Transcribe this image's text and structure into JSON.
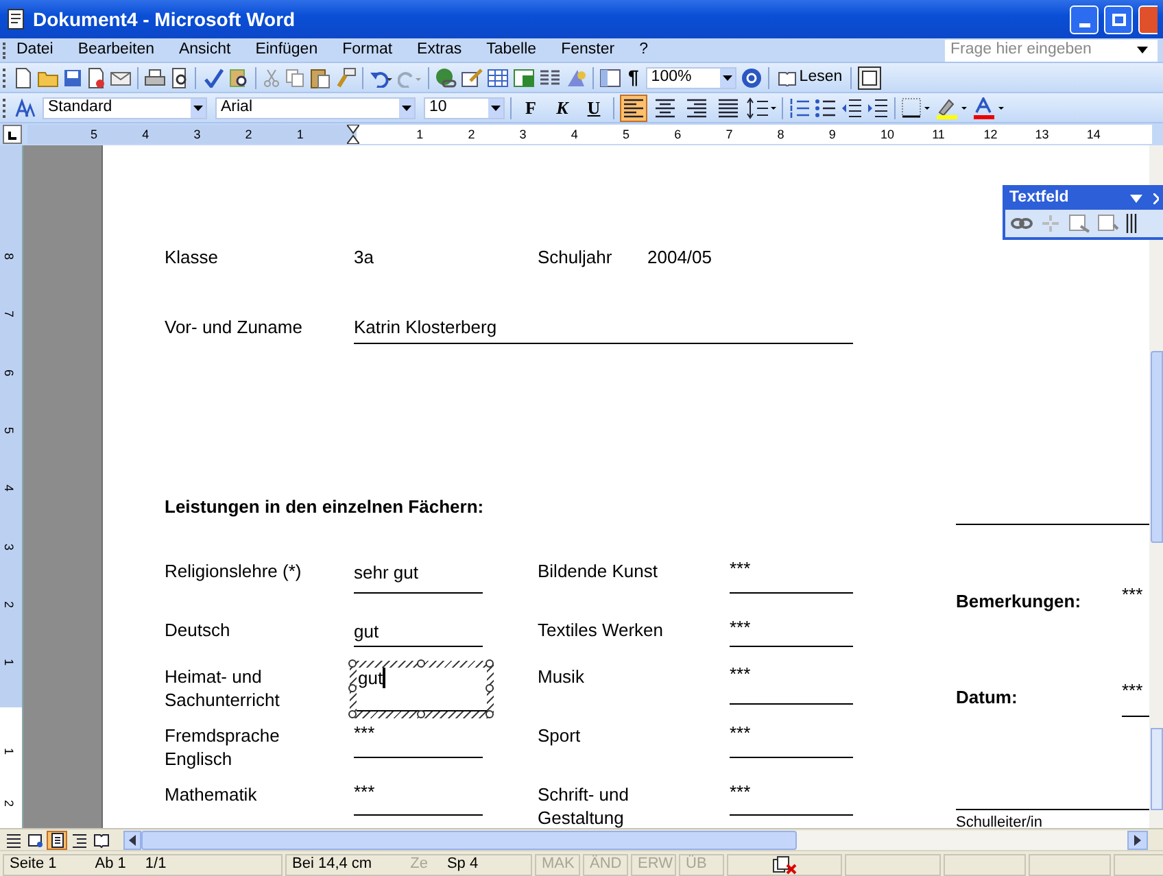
{
  "window": {
    "title": "Dokument4 - Microsoft Word"
  },
  "menu": [
    "Datei",
    "Bearbeiten",
    "Ansicht",
    "Einfügen",
    "Format",
    "Extras",
    "Tabelle",
    "Fenster",
    "?"
  ],
  "help_search": {
    "placeholder": "Frage hier eingeben"
  },
  "standard_toolbar": {
    "show_marks": "¶",
    "zoom": "100%",
    "read_button": "Lesen"
  },
  "format_toolbar": {
    "style": "Standard",
    "font": "Arial",
    "size": "10",
    "bold": "F",
    "italic": "K",
    "underline": "U",
    "alignments": [
      {
        "kind": "left",
        "selected": true
      },
      {
        "kind": "center",
        "selected": false
      },
      {
        "kind": "right",
        "selected": false
      },
      {
        "kind": "justify",
        "selected": false
      }
    ]
  },
  "ruler": {
    "left_ticks": [
      "5",
      "4",
      "3",
      "2",
      "1"
    ],
    "right_ticks": [
      "1",
      "2",
      "3",
      "4",
      "5",
      "6",
      "7",
      "8",
      "9",
      "10",
      "11",
      "12",
      "13",
      "14"
    ]
  },
  "vertical_ruler": {
    "upper_ticks": [
      "8",
      "7",
      "6",
      "5",
      "4",
      "3",
      "2",
      "1"
    ],
    "lower_ticks": [
      "1",
      "2"
    ]
  },
  "textbox_toolbar": {
    "title": "Textfeld"
  },
  "document": {
    "class_label": "Klasse",
    "class_value": "3a",
    "year_label": "Schuljahr",
    "year_value": "2004/05",
    "name_label": "Vor- und Zuname",
    "name_value": "Katrin Klosterberg",
    "heading": "Leistungen in den einzelnen Fächern:",
    "rows": [
      {
        "left": {
          "subject": [
            "Religionslehre (*)"
          ],
          "grade": "sehr gut",
          "selected": false
        },
        "right": {
          "subject": [
            "Bildende Kunst"
          ],
          "grade": "***",
          "selected": false
        }
      },
      {
        "left": {
          "subject": [
            "Deutsch"
          ],
          "grade": "gut",
          "selected": false
        },
        "right": {
          "subject": [
            "Textiles Werken"
          ],
          "grade": "***",
          "selected": false
        }
      },
      {
        "left": {
          "subject": [
            "Heimat- und",
            "Sachunterricht"
          ],
          "grade": "gut",
          "selected": true
        },
        "right": {
          "subject": [
            "Musik"
          ],
          "grade": "***",
          "selected": false
        }
      },
      {
        "left": {
          "subject": [
            "Fremdsprache",
            "Englisch"
          ],
          "grade": "***",
          "selected": false
        },
        "right": {
          "subject": [
            "Sport"
          ],
          "grade": "***",
          "selected": false
        }
      },
      {
        "left": {
          "subject": [
            "Mathematik"
          ],
          "grade": "***",
          "selected": false
        },
        "right": {
          "subject": [
            "Schrift- und",
            "Gestaltung"
          ],
          "grade": "***",
          "selected": false
        }
      }
    ],
    "remarks": {
      "label": "Bemerkungen:",
      "value": "***"
    },
    "date": {
      "label": "Datum:",
      "value": "***"
    },
    "signature": "Schulleiter/in"
  },
  "view_buttons": [
    {
      "kind": "normal",
      "selected": false
    },
    {
      "kind": "web",
      "selected": false
    },
    {
      "kind": "layout",
      "selected": true
    },
    {
      "kind": "outline",
      "selected": false
    },
    {
      "kind": "reading",
      "selected": false
    }
  ],
  "status_bar": [
    {
      "items": [
        {
          "text": "Seite 1",
          "disabled": false
        },
        {
          "text": "Ab 1",
          "disabled": false
        },
        {
          "text": "1/1",
          "disabled": false
        }
      ]
    },
    {
      "items": [
        {
          "text": "Bei 14,4 cm",
          "disabled": false
        },
        {
          "text": "Ze",
          "disabled": true
        },
        {
          "text": "Sp 4",
          "disabled": false
        }
      ]
    },
    {
      "items": [
        {
          "text": "MAK",
          "disabled": true
        }
      ]
    },
    {
      "items": [
        {
          "text": "ÄND",
          "disabled": true
        }
      ]
    },
    {
      "items": [
        {
          "text": "ERW",
          "disabled": true
        }
      ]
    },
    {
      "items": [
        {
          "text": "ÜB",
          "disabled": true
        }
      ]
    }
  ]
}
